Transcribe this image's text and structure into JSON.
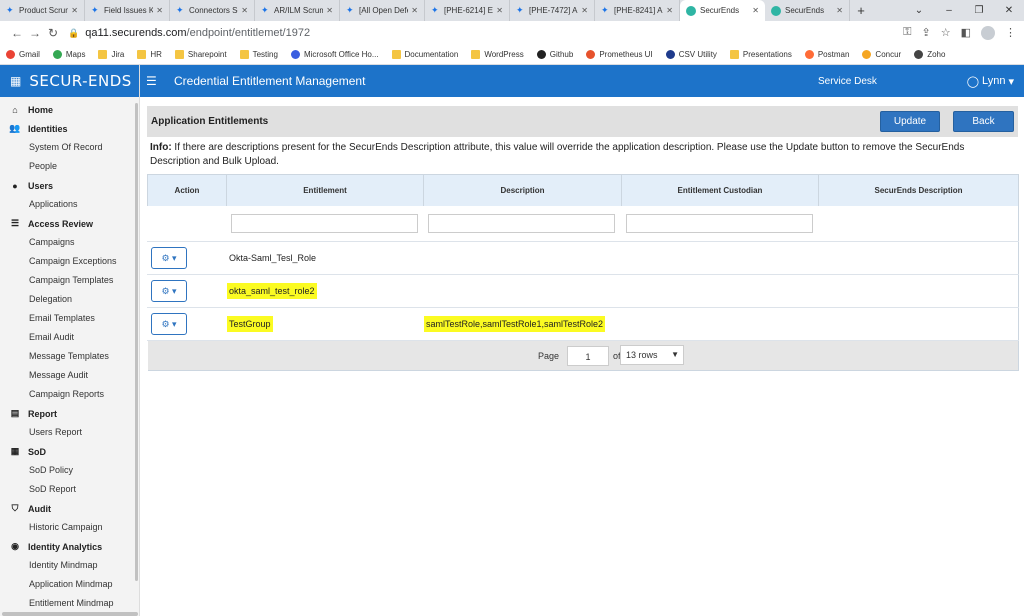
{
  "browser": {
    "tabs": [
      {
        "label": "Product Scrum",
        "active": false
      },
      {
        "label": "Field Issues Ka",
        "active": false
      },
      {
        "label": "Connectors Sc",
        "active": false
      },
      {
        "label": "AR/ILM Scrum",
        "active": false
      },
      {
        "label": "[All Open Defe",
        "active": false
      },
      {
        "label": "[PHE-6214] En",
        "active": false
      },
      {
        "label": "[PHE-7472] Au",
        "active": false
      },
      {
        "label": "[PHE-8241] Ap",
        "active": false
      },
      {
        "label": "SecurEnds",
        "active": true
      },
      {
        "label": "SecurEnds",
        "active": false
      }
    ],
    "url_host": "qa11.securends.com",
    "url_path": "/endpoint/entitlemet/1972",
    "bookmarks": [
      {
        "label": "Gmail",
        "icon": "gmail-icon"
      },
      {
        "label": "Maps",
        "icon": "maps-icon"
      },
      {
        "label": "Jira",
        "icon": "folder-icon"
      },
      {
        "label": "HR",
        "icon": "folder-icon"
      },
      {
        "label": "Sharepoint",
        "icon": "folder-icon"
      },
      {
        "label": "Testing",
        "icon": "folder-icon"
      },
      {
        "label": "Microsoft Office Ho...",
        "icon": "office-icon"
      },
      {
        "label": "Documentation",
        "icon": "folder-icon"
      },
      {
        "label": "WordPress",
        "icon": "folder-icon"
      },
      {
        "label": "Github",
        "icon": "github-icon"
      },
      {
        "label": "Prometheus UI",
        "icon": "prometheus-icon"
      },
      {
        "label": "CSV Utility",
        "icon": "csv-icon"
      },
      {
        "label": "Presentations",
        "icon": "folder-icon"
      },
      {
        "label": "Postman",
        "icon": "postman-icon"
      },
      {
        "label": "Concur",
        "icon": "concur-icon"
      },
      {
        "label": "Zoho",
        "icon": "globe-icon"
      }
    ]
  },
  "app": {
    "logo": "SECUR-ENDS",
    "title": "Credential Entitlement Management",
    "service_desk": "Service Desk",
    "user": "Lynn"
  },
  "sidebar": {
    "sections": [
      {
        "label": "Home",
        "icon": "home-icon",
        "items": []
      },
      {
        "label": "Identities",
        "icon": "users-icon",
        "items": [
          "System Of Record",
          "People"
        ]
      },
      {
        "label": "Users",
        "icon": "user-icon",
        "items": [
          "Applications"
        ]
      },
      {
        "label": "Access Review",
        "icon": "list-icon",
        "items": [
          "Campaigns",
          "Campaign Exceptions",
          "Campaign Templates",
          "Delegation",
          "Email Templates",
          "Email Audit",
          "Message Templates",
          "Message Audit",
          "Campaign Reports"
        ]
      },
      {
        "label": "Report",
        "icon": "file-icon",
        "items": [
          "Users Report"
        ]
      },
      {
        "label": "SoD",
        "icon": "table-icon",
        "items": [
          "SoD Policy",
          "SoD Report"
        ]
      },
      {
        "label": "Audit",
        "icon": "shield-icon",
        "items": [
          "Historic Campaign"
        ]
      },
      {
        "label": "Identity Analytics",
        "icon": "analytics-icon",
        "items": [
          "Identity Mindmap",
          "Application Mindmap",
          "Entitlement Mindmap"
        ]
      }
    ]
  },
  "panel": {
    "title": "Application Entitlements",
    "update_label": "Update",
    "back_label": "Back",
    "info_label": "Info:",
    "info_text": " If there are descriptions present for the SecurEnds Description attribute, this value will override the application description. Please use the Update button to remove the SecurEnds Description and Bulk Upload."
  },
  "table": {
    "columns": [
      "Action",
      "Entitlement",
      "Description",
      "Entitlement Custodian",
      "SecurEnds Description"
    ],
    "rows": [
      {
        "entitlement": "Okta-Saml_Tesl_Role",
        "description": "",
        "highlight_entitlement": false,
        "highlight_description": false
      },
      {
        "entitlement": "okta_saml_test_role2",
        "description": "",
        "highlight_entitlement": true,
        "highlight_description": false
      },
      {
        "entitlement": "TestGroup",
        "description": "samlTestRole,samlTestRole1,samlTestRole2",
        "highlight_entitlement": true,
        "highlight_description": true
      }
    ],
    "highlight_color": "#fbfb22"
  },
  "pager": {
    "page_label": "Page",
    "page_value": "1",
    "of_label": "of 1",
    "rows_option": "13 rows"
  }
}
